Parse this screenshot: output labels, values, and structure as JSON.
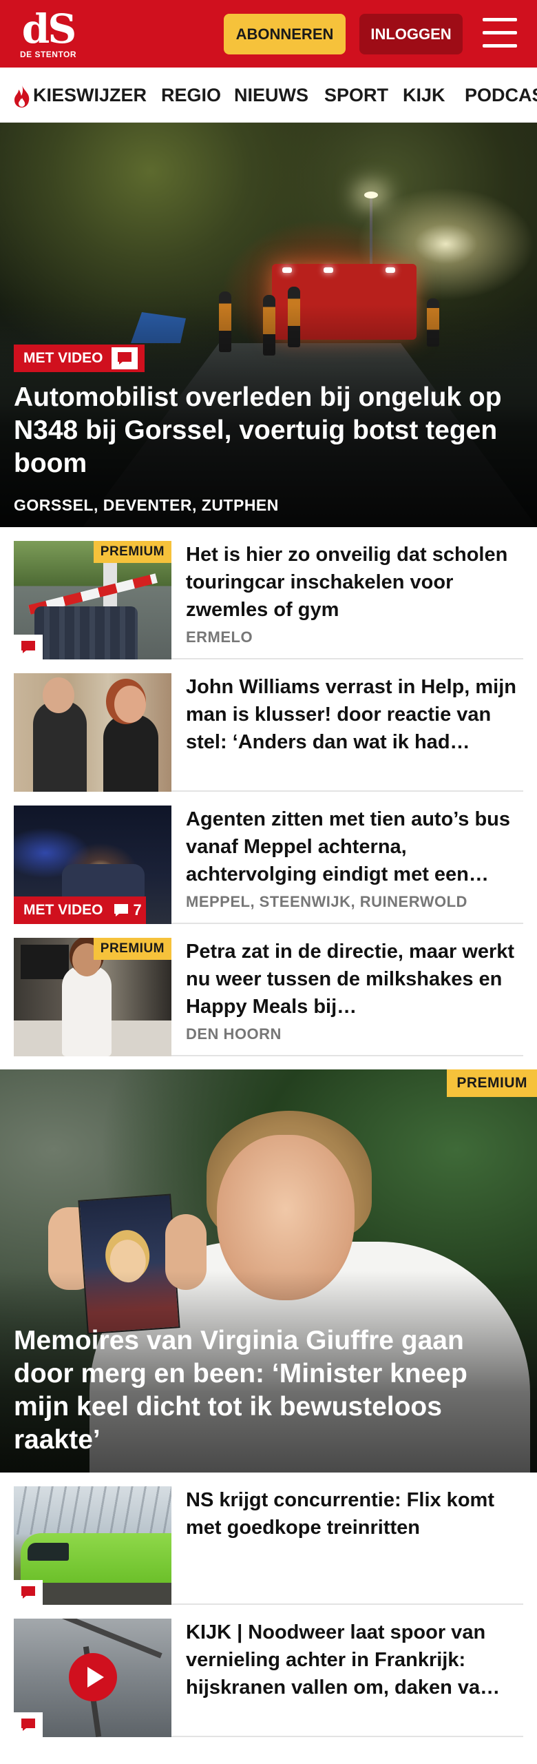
{
  "header": {
    "logo_mark": "dS",
    "logo_name": "DE STENTOR",
    "subscribe_label": "ABONNEREN",
    "login_label": "INLOGGEN",
    "menu_icon": "hamburger-menu-icon",
    "brand_color": "#d0101e",
    "accent_color": "#f6c23b"
  },
  "nav": {
    "items": [
      {
        "label": "KIESWIJZER",
        "icon": "flame-icon"
      },
      {
        "label": "REGIO"
      },
      {
        "label": "NIEUWS"
      },
      {
        "label": "SPORT"
      },
      {
        "label": "KIJK"
      },
      {
        "label": "PODCAS"
      }
    ]
  },
  "hero": {
    "badge": "MET VIDEO",
    "title": "Automobilist overleden bij ongeluk op N348 bij Gorssel, voertuig botst tegen boom",
    "locations": "GORSSEL, DEVENTER, ZUTPHEN"
  },
  "articles": [
    {
      "title": "Het is hier zo onveilig dat scholen touringcar inschakelen voor zwemles of gym",
      "meta": "ERMELO",
      "premium": "PREMIUM"
    },
    {
      "title": "John Williams verrast in Help, mijn man is klusser! door reactie van stel: ‘Anders dan wat ik had…",
      "meta": ""
    },
    {
      "title": "Agenten zitten met tien auto’s bus vanaf Meppel achterna, achtervolging eindigt met een…",
      "meta": "MEPPEL, STEENWIJK, RUINERWOLD",
      "badge": "MET VIDEO",
      "comment_count": "7"
    },
    {
      "title": "Petra zat in de directie, maar werkt nu weer tussen de milkshakes en Happy Meals bij…",
      "meta": "DEN HOORN",
      "premium": "PREMIUM"
    }
  ],
  "feature": {
    "premium": "PREMIUM",
    "title": "Memoires van Virginia Giuffre gaan door merg en been: ‘Minister kneep mijn keel dicht tot ik bewusteloos raakte’"
  },
  "articles_bottom": [
    {
      "title": "NS krijgt concurrentie: Flix komt met goedkope treinritten"
    },
    {
      "title": "KIJK | Noodweer laat spoor van vernieling achter in Frankrijk: hijskranen vallen om, daken va…"
    }
  ]
}
